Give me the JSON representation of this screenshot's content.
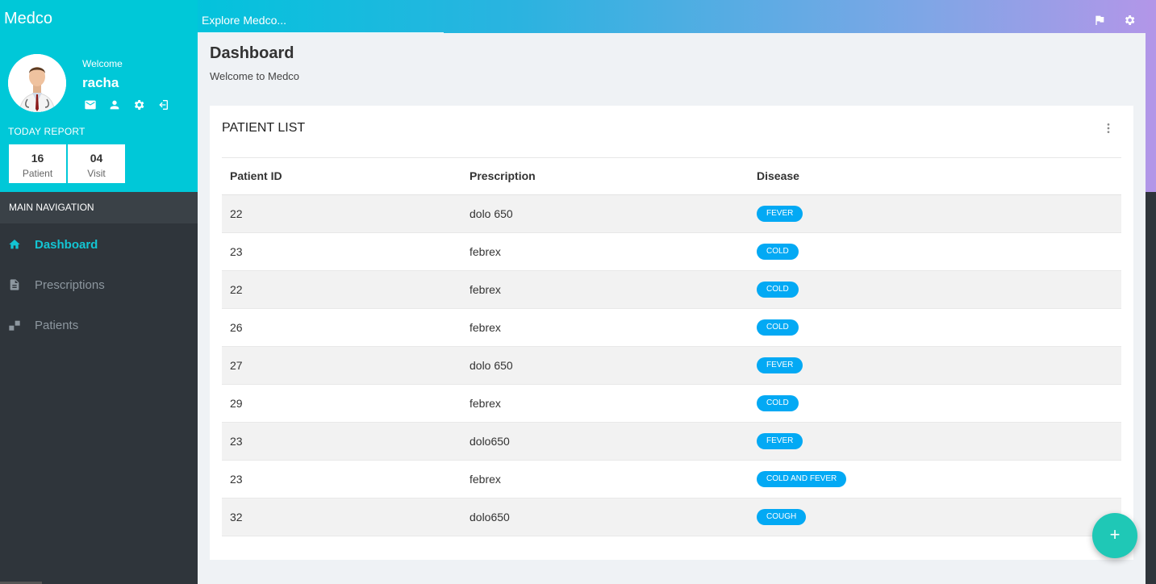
{
  "brand": "Medco",
  "topbar": {
    "explore_label": "Explore Medco...",
    "icons": [
      "flag-icon",
      "gear-icon"
    ]
  },
  "profile": {
    "welcome": "Welcome",
    "username": "racha",
    "icons": [
      "mail-icon",
      "user-icon",
      "gear-icon",
      "logout-icon"
    ]
  },
  "today_report": {
    "title": "TODAY REPORT",
    "stats": [
      {
        "value": "16",
        "label": "Patient"
      },
      {
        "value": "04",
        "label": "Visit"
      }
    ]
  },
  "nav": {
    "header": "MAIN NAVIGATION",
    "items": [
      {
        "label": "Dashboard",
        "icon": "home-icon",
        "active": true
      },
      {
        "label": "Prescriptions",
        "icon": "document-icon",
        "active": false
      },
      {
        "label": "Patients",
        "icon": "patients-icon",
        "active": false
      }
    ]
  },
  "page": {
    "title": "Dashboard",
    "subtitle": "Welcome to Medco"
  },
  "patient_list": {
    "title": "PATIENT LIST",
    "columns": [
      "Patient ID",
      "Prescription",
      "Disease"
    ],
    "rows": [
      {
        "id": "22",
        "prescription": "dolo 650",
        "disease": "FEVER"
      },
      {
        "id": "23",
        "prescription": "febrex",
        "disease": "COLD"
      },
      {
        "id": "22",
        "prescription": "febrex",
        "disease": "COLD"
      },
      {
        "id": "26",
        "prescription": "febrex",
        "disease": "COLD"
      },
      {
        "id": "27",
        "prescription": "dolo 650",
        "disease": "FEVER"
      },
      {
        "id": "29",
        "prescription": "febrex",
        "disease": "COLD"
      },
      {
        "id": "23",
        "prescription": "dolo650",
        "disease": "FEVER"
      },
      {
        "id": "23",
        "prescription": "febrex",
        "disease": "COLD AND FEVER"
      },
      {
        "id": "32",
        "prescription": "dolo650",
        "disease": "COUGH"
      }
    ]
  },
  "fab_label": "+",
  "colors": {
    "accent": "#13c5d3",
    "pill": "#03a9f4",
    "fab": "#1fc8b6",
    "sidebar": "#2f353b"
  }
}
